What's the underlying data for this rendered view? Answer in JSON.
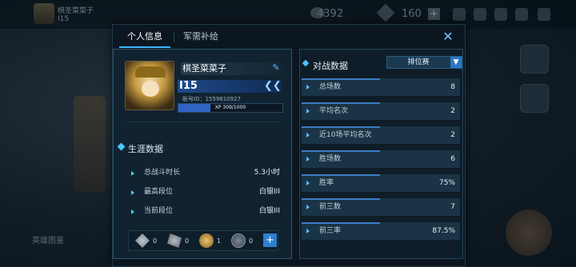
{
  "background": {
    "player_name": "棋圣菜菜子",
    "player_sub": "I15",
    "gold": "4392",
    "gems": "160",
    "plus": "+",
    "left_button": "英雄图鉴"
  },
  "dialog": {
    "tabs": [
      {
        "label": "个人信息",
        "active": true
      },
      {
        "label": "军需补给",
        "active": false
      }
    ],
    "close": "✕"
  },
  "profile": {
    "nickname": "棋圣菜菜子",
    "rank": "I15",
    "rank_chevron": "❮❮",
    "account_id": "账号ID：1559810927",
    "xp_text": "XP 309/1000",
    "xp_fraction": 0.309,
    "career_title": "生涯数据",
    "career_rows": [
      {
        "label": "总战斗时长",
        "value": "5.3小时"
      },
      {
        "label": "最高段位",
        "value": "白银III"
      },
      {
        "label": "当前段位",
        "value": "白银III"
      }
    ],
    "medals": [
      {
        "icon": "diamond-medal-icon",
        "count": "0"
      },
      {
        "icon": "sword-medal-icon",
        "count": "0"
      },
      {
        "icon": "gold-medal-icon",
        "count": "1"
      },
      {
        "icon": "shield-medal-icon",
        "count": "0"
      }
    ],
    "add_button": "+"
  },
  "battle": {
    "title": "对战数据",
    "mode": "排位赛",
    "rows": [
      {
        "label": "总场数",
        "value": "8"
      },
      {
        "label": "平均名次",
        "value": "2"
      },
      {
        "label": "近10场平均名次",
        "value": "2"
      },
      {
        "label": "胜场数",
        "value": "6"
      },
      {
        "label": "胜率",
        "value": "75%"
      },
      {
        "label": "前三数",
        "value": "7"
      },
      {
        "label": "前三率",
        "value": "87.5%"
      }
    ]
  },
  "colors": {
    "accent": "#39b8ff",
    "panel": "#112330",
    "row": "#1a3446"
  }
}
